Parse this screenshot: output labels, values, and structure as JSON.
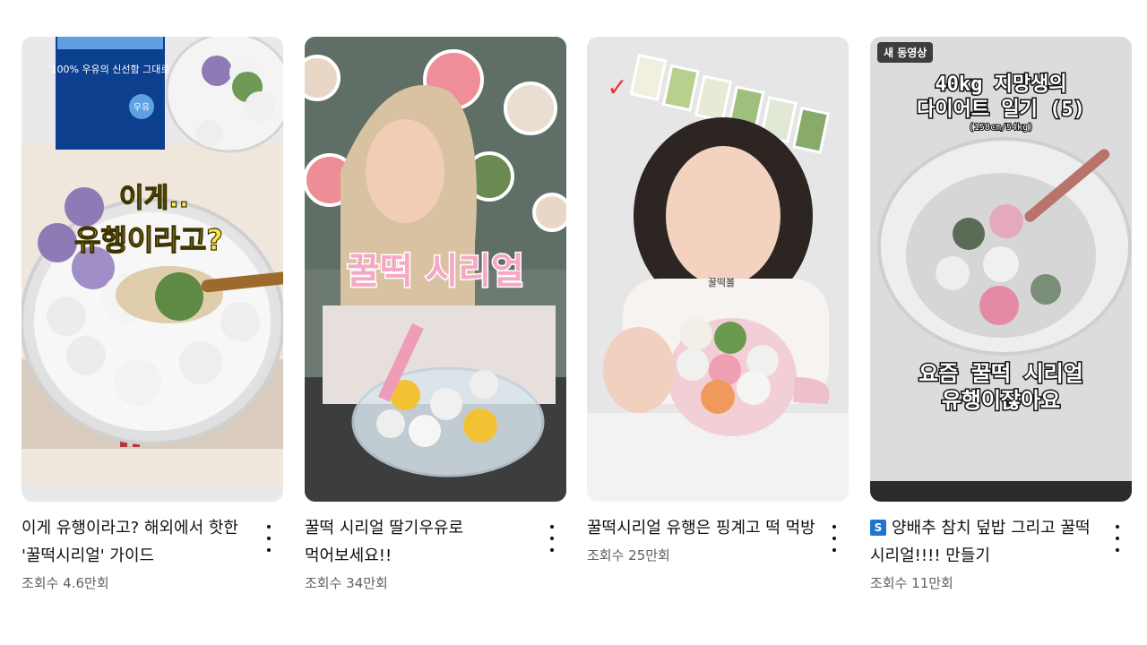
{
  "videos": [
    {
      "title": "이게 유행이라고? 해외에서 핫한 '꿀떡시리얼' 가이드",
      "views": "조회수 4.6만회",
      "thumb": {
        "line1": "이게..",
        "line2": "유행이라고?",
        "carton": "100% 우유의 신선함 그대로",
        "carton_label": "우유"
      }
    },
    {
      "title": "꿀떡 시리얼 딸기우유로 먹어보세요!!",
      "views": "조회수 34만회",
      "thumb": {
        "line1": "꿀떡 시리얼"
      }
    },
    {
      "title": "꿀떡시리얼 유행은 핑계고 떡 먹방",
      "views": "조회수 25만회",
      "thumb": {
        "line1": "꿀떡볼",
        "check": "✓"
      }
    },
    {
      "badge": "S",
      "title": "양배추 참치 덮밥 그리고 꿀떡 시리얼!!!! 만들기",
      "views": "조회수 11만회",
      "thumb": {
        "new_badge": "새 동영상",
        "head1": "40kg 지망생의",
        "head2": "다이어트 일기 (5)",
        "head3": "(158cm/54kg)",
        "line1": "요즘 꿀떡 시리얼",
        "line2": "유행이잖아요"
      }
    }
  ],
  "colors": {
    "title": "#0f0f0f",
    "meta": "#606060",
    "overlay_yellow": "#f7e54a",
    "overlay_pink": "#f36f9a",
    "badge_blue": "#1f74d1"
  }
}
